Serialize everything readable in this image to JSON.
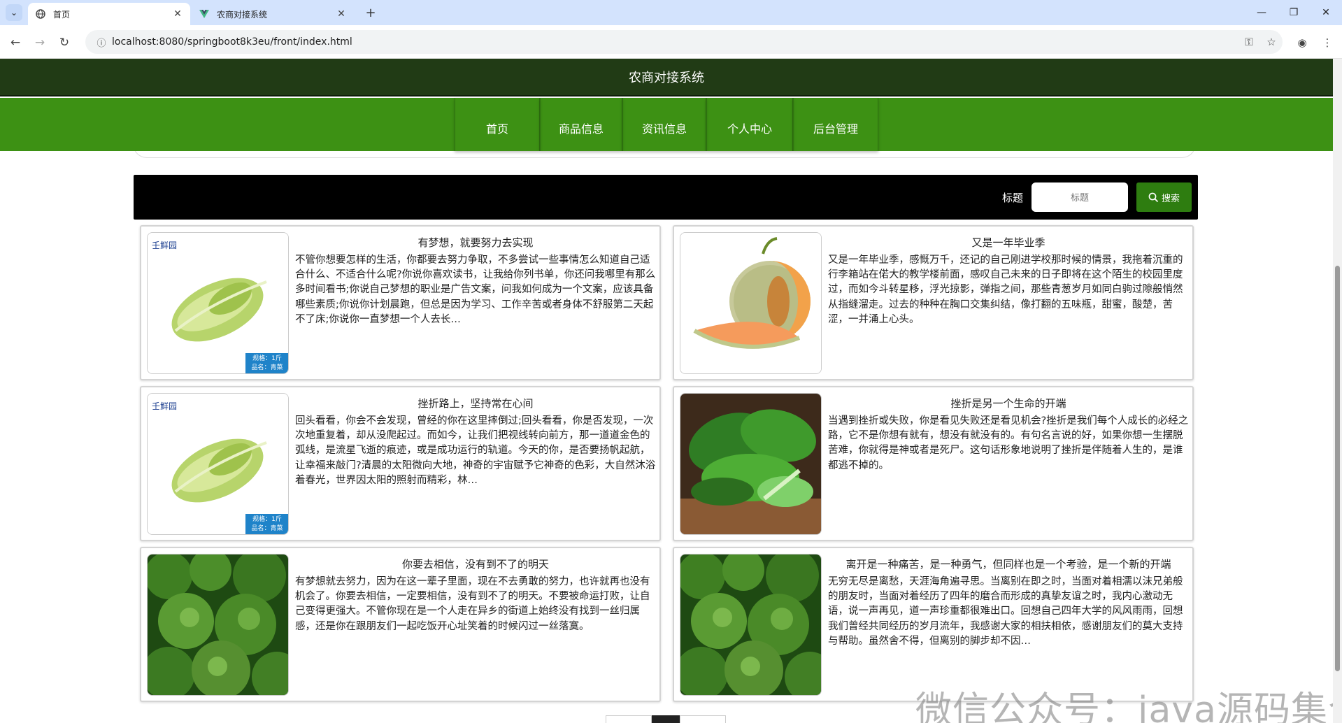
{
  "browser": {
    "tabs": [
      {
        "title": "首页",
        "active": true
      },
      {
        "title": "农商对接系统",
        "active": false
      }
    ],
    "url": "localhost:8080/springboot8k3eu/front/index.html"
  },
  "site": {
    "title": "农商对接系统",
    "nav": [
      "首页",
      "商品信息",
      "资讯信息",
      "个人中心",
      "后台管理"
    ]
  },
  "search": {
    "label": "标题",
    "placeholder": "标题",
    "button": "搜索"
  },
  "articles": [
    {
      "title": "有梦想，就要努力去实现",
      "summary": "不管你想要怎样的生活，你都要去努力争取，不多尝试一些事情怎么知道自己适合什么、不适合什么呢?你说你喜欢读书，让我给你列书单，你还问我哪里有那么多时间看书;你说自己梦想的职业是广告文案，问我如何成为一个文案，应该具备哪些素质;你说你计划晨跑，但总是因为学习、工作辛苦或者身体不舒服第二天起不了床;你说你一直梦想一个人去长…",
      "image": "lettuce",
      "badge": [
        "规格：1斤",
        "品名：青菜"
      ]
    },
    {
      "title": "又是一年毕业季",
      "summary": "又是一年毕业季，感慨万千，还记的自己刚进学校那时候的情景，我拖着沉重的行李箱站在偌大的教学楼前面，感叹自己未来的日子即将在这个陌生的校园里度过，而如今斗转星移，浮光掠影，弹指之间，那些青葱岁月如同白驹过隙般悄然从指缝溜走。过去的种种在胸口交集纠结，像打翻的五味瓶，甜蜜，酸楚，苦涩，一并涌上心头。",
      "image": "melon"
    },
    {
      "title": "挫折路上，坚持常在心间",
      "summary": "回头看看，你会不会发现，曾经的你在这里摔倒过;回头看看，你是否发现，一次次地重复着，却从没爬起过。而如今，让我们把视线转向前方，那一道道金色的弧线，是流星飞逝的痕迹，或是成功运行的轨道。今天的你，是否要扬帆起航，让幸福来敲门?清晨的太阳微向大地，神奇的宇宙赋予它神奇的色彩，大自然沐浴着春光，世界因太阳的照射而精彩，林…",
      "image": "lettuce",
      "badge": [
        "规格：1斤",
        "品名：青菜"
      ]
    },
    {
      "title": "挫折是另一个生命的开端",
      "summary": "当遇到挫折或失败，你是看见失败还是看见机会?挫折是我们每个人成长的必经之路，它不是你想有就有，想没有就没有的。有句名言说的好，如果你想一生摆脱苦难，你就得是神或者是死尸。这句话形象地说明了挫折是伴随着人生的，是谁都逃不掉的。",
      "image": "greens"
    },
    {
      "title": "你要去相信，没有到不了的明天",
      "summary": "有梦想就去努力，因为在这一辈子里面，现在不去勇敢的努力，也许就再也没有机会了。你要去相信，一定要相信，没有到不了的明天。不要被命运打败，让自己变得更强大。不管你现在是一个人走在异乡的街道上始终没有找到一丝归属感，还是你在跟朋友们一起吃饭开心址笑着的时候闪过一丝落寞。",
      "image": "broccoli"
    },
    {
      "title": "离开是一种痛苦，是一种勇气，但同样也是一个考验，是一个新的开端",
      "summary": "无穷无尽是离愁，天涯海角遍寻思。当离别在即之时，当面对着相濡以沫兄弟般的朋友时，当面对着经历了四年的磨合而形成的真挚友谊之时，我内心激动无语，说一声再见，道一声珍重都很难出口。回想自己四年大学的风风雨雨，回想我们曾经共同经历的岁月流年，我感谢大家的相扶相依，感谢朋友们的莫大支持与帮助。虽然舍不得，但离别的脚步却不因…",
      "image": "broccoli"
    }
  ],
  "watermark": "微信公众号：java源码集合"
}
